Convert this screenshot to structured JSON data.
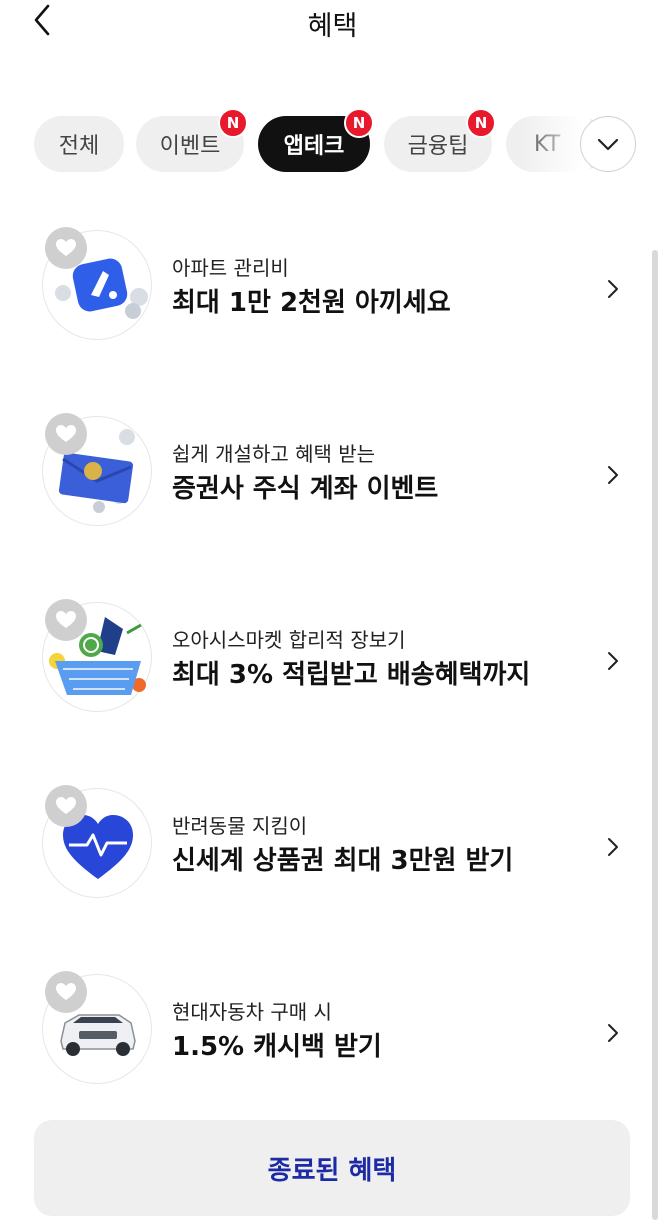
{
  "header": {
    "title": "혜택",
    "back_icon": "chevron-left-icon"
  },
  "tabs": [
    {
      "label": "전체",
      "badge": "",
      "active": false
    },
    {
      "label": "이벤트",
      "badge": "N",
      "active": false
    },
    {
      "label": "앱테크",
      "badge": "N",
      "active": true
    },
    {
      "label": "금융팁",
      "badge": "N",
      "active": false
    },
    {
      "label": "KT",
      "badge": "",
      "active": false
    }
  ],
  "more_icon": "chevron-down-icon",
  "items": [
    {
      "subtitle": "아파트 관리비",
      "title": "최대 1만 2천원 아끼세요",
      "image": "app-logo-coins"
    },
    {
      "subtitle": "쉽게 개설하고 혜택 받는",
      "title": "증권사 주식 계좌 이벤트",
      "image": "blue-envelope-coins"
    },
    {
      "subtitle": "오아시스마켓 합리적 장보기",
      "title": "최대 3% 적립받고 배송혜택까지",
      "image": "grocery-basket"
    },
    {
      "subtitle": "반려동물 지킴이",
      "title": "신세계 상품권 최대 3만원 받기",
      "image": "blue-heart-pulse"
    },
    {
      "subtitle": "현대자동차 구매 시",
      "title": "1.5% 캐시백 받기",
      "image": "white-suv"
    }
  ],
  "footer": {
    "ended_label": "종료된 혜택"
  }
}
